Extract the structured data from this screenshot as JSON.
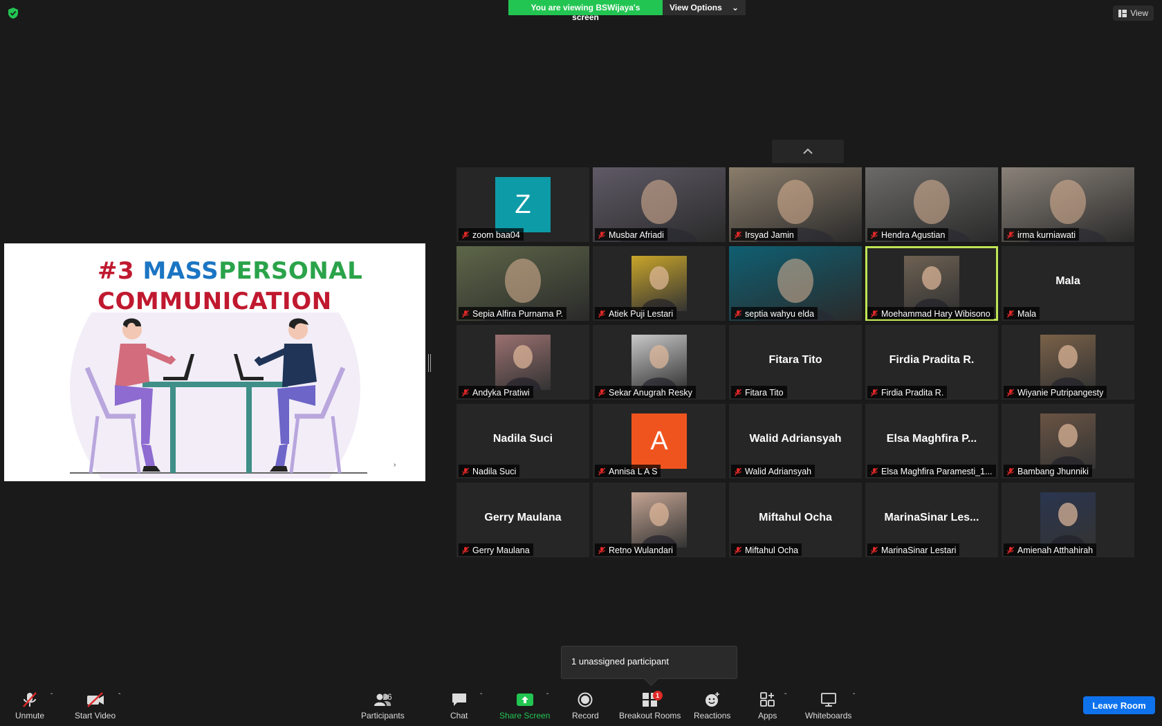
{
  "banner": {
    "viewing_text": "You are viewing BSWijaya's screen",
    "view_options_label": "View Options"
  },
  "view_button_label": "View",
  "slide": {
    "title_part1": "#3 ",
    "title_part2": "MASS",
    "title_part3": "PERSONAL",
    "title_line2": "COMMUNICATION"
  },
  "participants": [
    {
      "display": "letter",
      "letter": "Z",
      "color": "#0e9ba8",
      "name": "zoom baa04"
    },
    {
      "display": "photo-full",
      "color": "#5f5a66",
      "name": "Musbar Afriadi"
    },
    {
      "display": "photo-full",
      "color": "#8a7d6b",
      "name": "Irsyad Jamin"
    },
    {
      "display": "photo-full",
      "color": "#6b6a68",
      "name": "Hendra Agustian"
    },
    {
      "display": "photo-full",
      "color": "#8a8279",
      "name": "irma kurniawati"
    },
    {
      "display": "photo-full",
      "color": "#5d6648",
      "name": "Sepia Alfira Purnama P."
    },
    {
      "display": "photo-small",
      "color": "#c9a52a",
      "name": "Atiek Puji Lestari"
    },
    {
      "display": "photo-full",
      "color": "#0f5f72",
      "name": "septia wahyu elda"
    },
    {
      "display": "photo-small",
      "color": "#6e6152",
      "name": "Moehammad Hary Wibisono",
      "active": true
    },
    {
      "display": "text",
      "big": "Mala",
      "name": "Mala"
    },
    {
      "display": "photo-small",
      "color": "#9b7070",
      "name": "Andyka Pratiwi"
    },
    {
      "display": "photo-small",
      "color": "#c8c8c8",
      "name": "Sekar Anugrah Resky"
    },
    {
      "display": "text",
      "big": "Fitara Tito",
      "name": "Fitara Tito"
    },
    {
      "display": "text",
      "big": "Firdia Pradita R.",
      "name": "Firdia Pradita R."
    },
    {
      "display": "photo-small",
      "color": "#7a6148",
      "name": "Wiyanie Putripangesty"
    },
    {
      "display": "text",
      "big": "Nadila Suci",
      "name": "Nadila Suci"
    },
    {
      "display": "letter",
      "letter": "A",
      "color": "#f0541e",
      "name": "Annisa L A S"
    },
    {
      "display": "text",
      "big": "Walid Adriansyah",
      "name": "Walid Adriansyah"
    },
    {
      "display": "text",
      "big": "Elsa Maghfira P...",
      "name": "Elsa Maghfira Paramesti_1..."
    },
    {
      "display": "photo-small",
      "color": "#6a5444",
      "name": "Bambang Jhunniki"
    },
    {
      "display": "text",
      "big": "Gerry Maulana",
      "name": "Gerry Maulana"
    },
    {
      "display": "photo-small",
      "color": "#c4a493",
      "name": "Retno Wulandari"
    },
    {
      "display": "text",
      "big": "Miftahul Ocha",
      "name": "Miftahul Ocha"
    },
    {
      "display": "text",
      "big": "MarinaSinar Les...",
      "name": "MarinaSinar Lestari"
    },
    {
      "display": "photo-small",
      "color": "#2a3550",
      "name": "Amienah Atthahirah"
    }
  ],
  "tooltip": "1 unassigned participant",
  "toolbar": {
    "unmute": "Unmute",
    "start_video": "Start Video",
    "participants": "Participants",
    "participants_count": "26",
    "chat": "Chat",
    "share_screen": "Share Screen",
    "record": "Record",
    "breakout_rooms": "Breakout Rooms",
    "breakout_badge": "1",
    "reactions": "Reactions",
    "apps": "Apps",
    "whiteboards": "Whiteboards",
    "leave_room": "Leave Room"
  }
}
